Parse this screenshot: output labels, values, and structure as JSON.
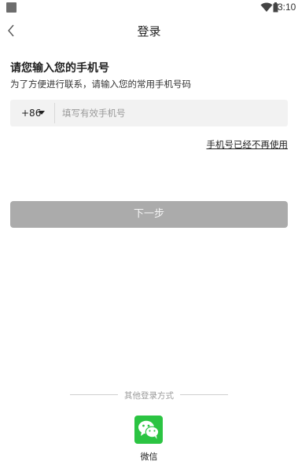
{
  "status_bar": {
    "time": "3:10",
    "icons": [
      "notification-square-icon",
      "wifi-icon",
      "battery-icon"
    ]
  },
  "nav": {
    "title": "登录",
    "back_icon": "chevron-left-icon"
  },
  "form": {
    "heading": "请您输入您的手机号",
    "subheading": "为了方便进行联系，请输入您的常用手机号码",
    "country_code": "+86",
    "phone_value": "",
    "phone_placeholder": "填写有效手机号",
    "no_longer_link": "手机号已经不再使用",
    "next_button": "下一步"
  },
  "other_login": {
    "label": "其他登录方式",
    "wechat_label": "微信",
    "wechat_icon": "wechat-icon"
  },
  "colors": {
    "button_disabled": "#ababab",
    "input_bg": "#f2f2f2",
    "wechat_green": "#2bc442"
  }
}
